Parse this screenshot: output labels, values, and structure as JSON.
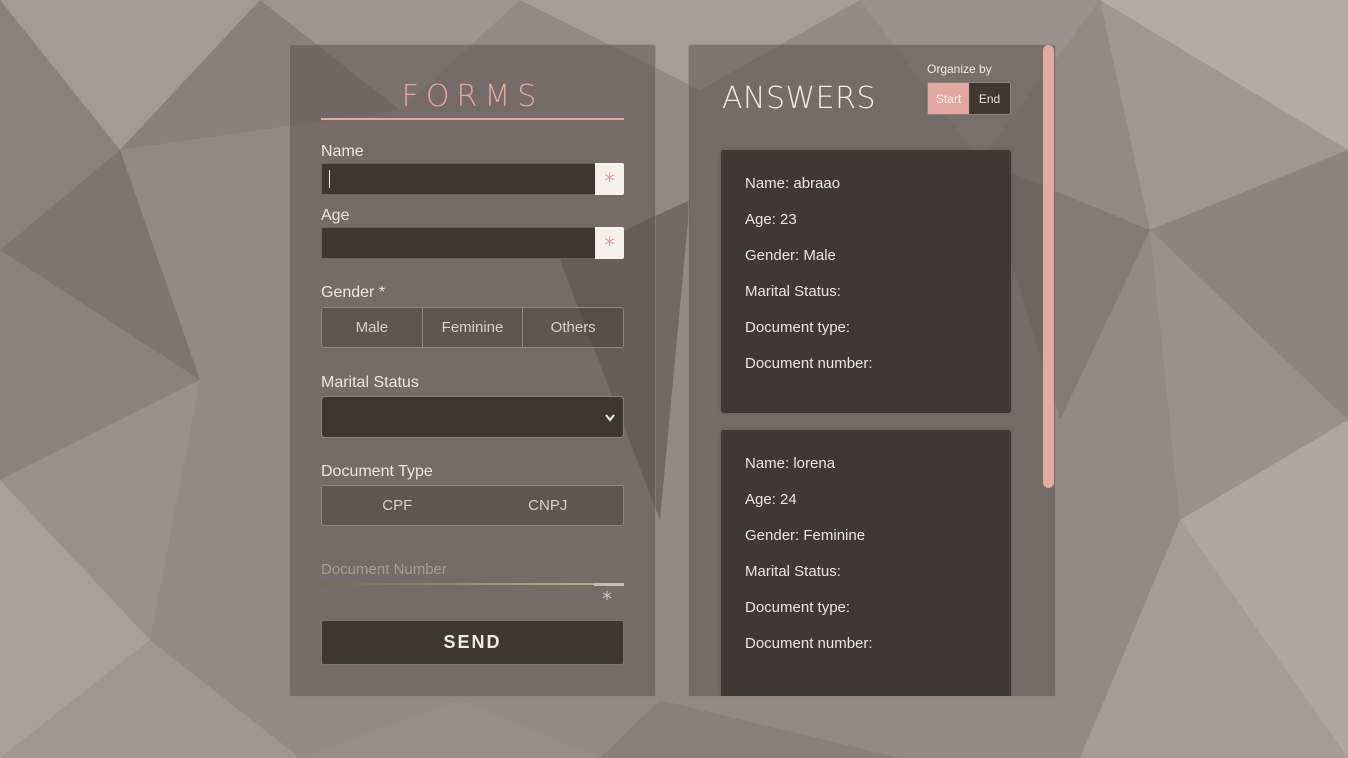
{
  "forms": {
    "title": "FORMS",
    "name_label": "Name",
    "age_label": "Age",
    "required_mark": "*",
    "gender_label": "Gender *",
    "gender_options": [
      "Male",
      "Feminine",
      "Others"
    ],
    "marital_label": "Marital Status",
    "document_type_label": "Document Type",
    "document_type_options": [
      "CPF",
      "CNPJ"
    ],
    "document_number_placeholder": "Document Number",
    "send_label": "SEND"
  },
  "answers": {
    "title": "ANSWERS",
    "organize_label": "Organize by",
    "organize_options": [
      "Start",
      "End"
    ],
    "cards": [
      {
        "name": "Name: abraao",
        "age": "Age: 23",
        "gender": "Gender: Male",
        "marital": "Marital Status:",
        "doc_type": "Document type:",
        "doc_number": "Document number:"
      },
      {
        "name": "Name: lorena",
        "age": "Age: 24",
        "gender": "Gender: Feminine",
        "marital": "Marital Status:",
        "doc_type": "Document type:",
        "doc_number": "Document number:"
      }
    ]
  },
  "colors": {
    "accent": "#e3a9a0",
    "panel_bg": "#5c5450",
    "input_bg": "#3d3734"
  },
  "icons": {
    "select_chevron": "chevron-down-icon"
  }
}
